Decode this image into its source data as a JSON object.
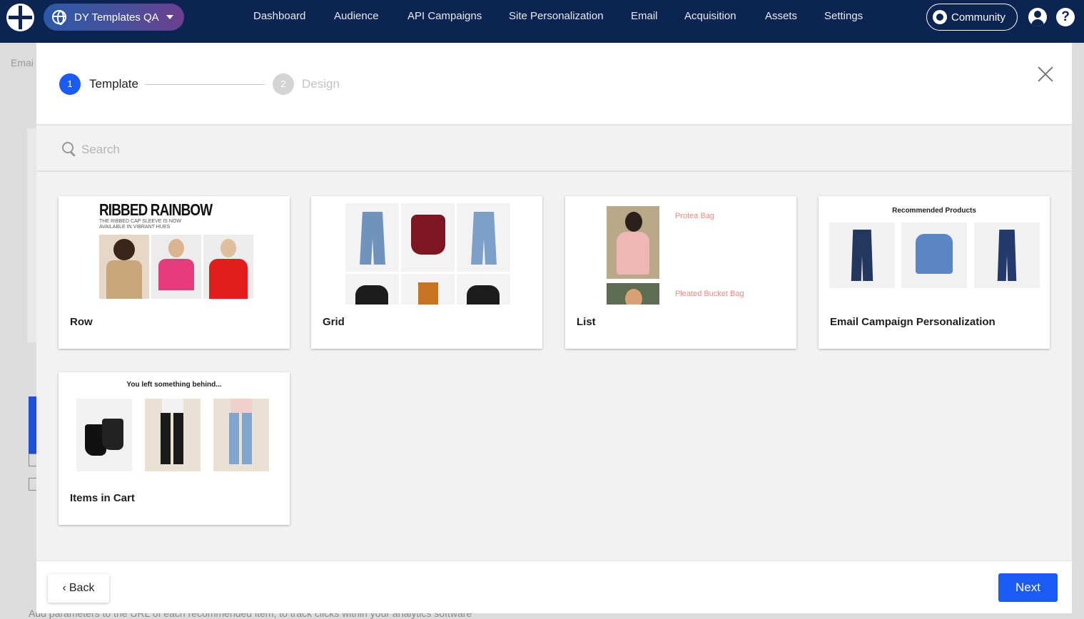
{
  "header": {
    "site_selector": "DY Templates QA",
    "nav": [
      "Dashboard",
      "Audience",
      "API Campaigns",
      "Site Personalization",
      "Email",
      "Acquisition",
      "Assets",
      "Settings"
    ],
    "community": "Community"
  },
  "background": {
    "fragment_email": "Emai",
    "fragment_bottom": "Add parameters to the URL of each recommended item, to track clicks within your analytics software"
  },
  "wizard": {
    "steps": [
      {
        "number": "1",
        "label": "Template"
      },
      {
        "number": "2",
        "label": "Design"
      }
    ]
  },
  "search": {
    "placeholder": "Search"
  },
  "templates": [
    {
      "title": "Row",
      "thumb_heading": "RIBBED RAINBOW",
      "thumb_subheading": "THE RIBBED CAP SLEEVE IS NOW AVAILABLE IN VIBRANT HUES"
    },
    {
      "title": "Grid"
    },
    {
      "title": "List",
      "thumb_items": [
        "Protea Bag",
        "Pleated Bucket Bag"
      ]
    },
    {
      "title": "Email Campaign Personalization",
      "thumb_heading": "Recommended Products"
    },
    {
      "title": "Items in Cart",
      "thumb_heading": "You left something behind..."
    }
  ],
  "footer": {
    "back": "Back",
    "next": "Next"
  },
  "colors": {
    "nav_bg": "#0b2452",
    "primary": "#1a5af5",
    "modal_bg": "#f2f2f2"
  }
}
